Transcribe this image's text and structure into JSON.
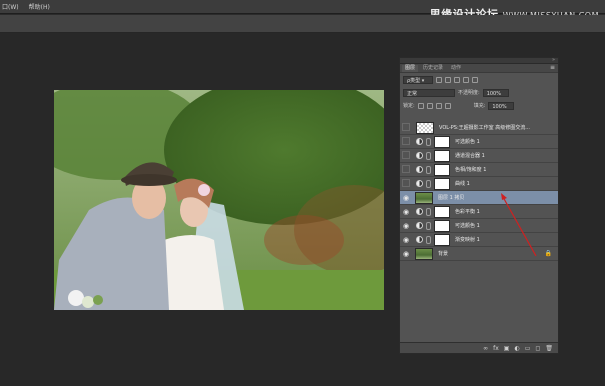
{
  "menubar": {
    "items": [
      "口(W)",
      "帮助(H)"
    ]
  },
  "watermark": {
    "main": "思缘设计论坛",
    "url": "WWW.MISSYUAN.COM"
  },
  "panel": {
    "tabs": [
      "图层",
      "历史记录",
      "动作"
    ],
    "kind_label": "ρ类型",
    "blend_mode": "正常",
    "opacity_label": "不透明度:",
    "opacity_value": "100%",
    "lock_label": "锁定:",
    "fill_label": "填充:",
    "fill_value": "100%"
  },
  "layers": [
    {
      "name": "VOL-PS:王超摄影工作室   高级修图交流...",
      "visible": false,
      "type": "text"
    },
    {
      "name": "可选颜色 1",
      "visible": false,
      "type": "adjustment"
    },
    {
      "name": "通道混合器 1",
      "visible": false,
      "type": "adjustment"
    },
    {
      "name": "色相/饱和度 1",
      "visible": false,
      "type": "adjustment"
    },
    {
      "name": "曲线 1",
      "visible": false,
      "type": "adjustment"
    },
    {
      "name": "图层 1 拷贝",
      "visible": true,
      "type": "pixel",
      "selected": true
    },
    {
      "name": "色彩平衡 1",
      "visible": true,
      "type": "adjustment"
    },
    {
      "name": "可选颜色 1",
      "visible": true,
      "type": "adjustment"
    },
    {
      "name": "渐变映射 1",
      "visible": true,
      "type": "adjustment"
    },
    {
      "name": "背景",
      "visible": true,
      "type": "background",
      "locked": true
    }
  ],
  "colors": {
    "accent_selected": "#7c8fa8",
    "annotation_arrow": "#d02020"
  }
}
